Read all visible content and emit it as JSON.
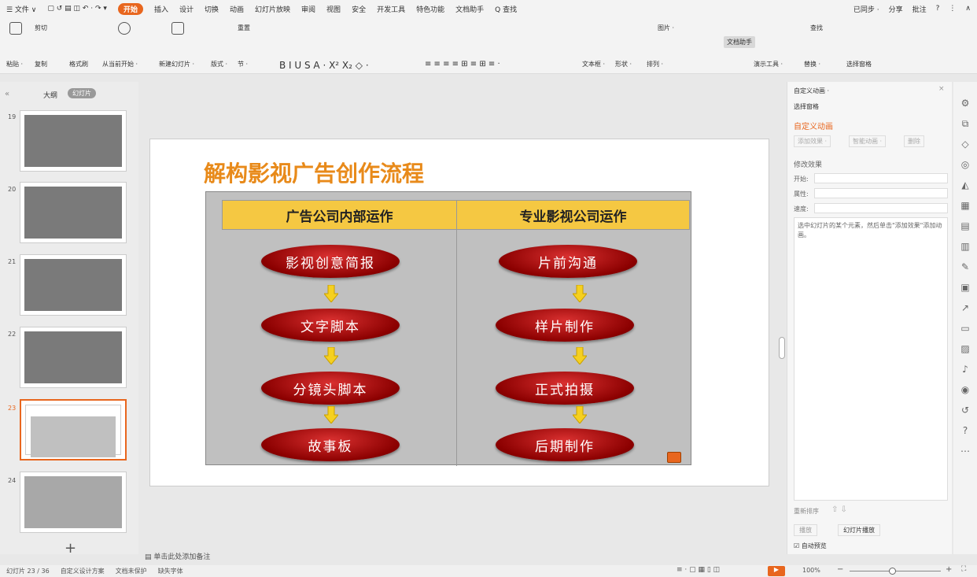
{
  "menubar": {
    "items": [
      "☰ 文件 ∨",
      "开始",
      "插入",
      "设计",
      "切换",
      "动画",
      "幻灯片放映",
      "审阅",
      "视图",
      "安全",
      "开发工具",
      "特色功能",
      "文档助手",
      "Q 查找"
    ],
    "active_index": 1,
    "right": [
      "已同步 ·",
      "分享",
      "批注",
      "?",
      "⋮",
      "∧"
    ]
  },
  "ribbon": {
    "paste": "粘贴 ·",
    "cut": "剪切",
    "copy": "复制",
    "format_painter": "格式刷",
    "from_current": "从当前开始 ·",
    "new_slide": "新建幻灯片 ·",
    "layout": "版式 ·",
    "section": "节 ·",
    "reset": "重置",
    "textbox": "文本框 ·",
    "shape": "形状 ·",
    "arrange": "排列 ·",
    "picture": "图片 ·",
    "doc_assistant": "文档助手",
    "demo_tool": "演示工具 ·",
    "replace": "替换 ·",
    "select_pane": "选择窗格",
    "find": "查找"
  },
  "leftpane": {
    "tabs": [
      "大纲",
      "幻灯片"
    ],
    "slides": [
      19,
      20,
      21,
      22,
      23,
      24
    ],
    "add_label": "+"
  },
  "slide": {
    "title": "解构影视广告创作流程",
    "col1_header": "广告公司内部运作",
    "col2_header": "专业影视公司运作",
    "col1_steps": [
      "影视创意简报",
      "文字脚本",
      "分镜头脚本",
      "故事板"
    ],
    "col2_steps": [
      "片前沟通",
      "样片制作",
      "正式拍摄",
      "后期制作"
    ]
  },
  "notes_placeholder": "单击此处添加备注",
  "rightpanel": {
    "title": "自定义动画 ·",
    "select_pane": "选择窗格",
    "section": "自定义动画",
    "add_effect": "添加效果 ·",
    "smart_anim": "智能动画 ·",
    "delete": "删除",
    "modify": "修改效果",
    "start": "开始:",
    "property": "属性:",
    "speed": "速度:",
    "hint": "选中幻灯片的某个元素，然后单击\"添加效果\"添加动画。",
    "reorder": "重新排序",
    "play": "播放",
    "slideshow": "幻灯片播放",
    "autopreview": "自动预览"
  },
  "statusbar": {
    "slide_pos": "幻灯片 23 / 36",
    "theme": "自定义设计方案",
    "protect": "文档未保护",
    "font_missing": "缺失字体",
    "zoom": "100%"
  },
  "colors": {
    "accent": "#e8661e",
    "title": "#e88a1a",
    "header": "#f5c842",
    "oval": "#8b0000"
  }
}
